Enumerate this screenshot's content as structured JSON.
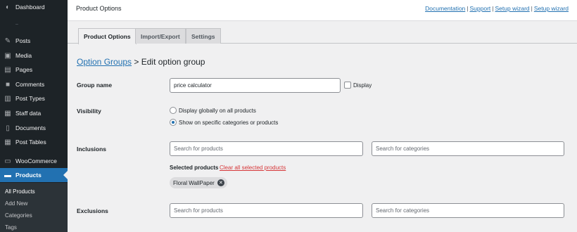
{
  "sidebar": {
    "items": [
      {
        "label": "Dashboard",
        "icon": "dashboard-icon"
      },
      {
        "label": "Posts",
        "icon": "pin-icon"
      },
      {
        "label": "Media",
        "icon": "media-icon"
      },
      {
        "label": "Pages",
        "icon": "pages-icon"
      },
      {
        "label": "Comments",
        "icon": "comments-icon"
      },
      {
        "label": "Post Types",
        "icon": "post-types-icon"
      },
      {
        "label": "Staff data",
        "icon": "table-icon"
      },
      {
        "label": "Documents",
        "icon": "document-icon"
      },
      {
        "label": "Post Tables",
        "icon": "table-icon"
      },
      {
        "label": "WooCommerce",
        "icon": "woocommerce-icon"
      },
      {
        "label": "Products",
        "icon": "products-icon"
      }
    ],
    "submenu": [
      "All Products",
      "Add New",
      "Categories",
      "Tags"
    ]
  },
  "header": {
    "title": "Product Options",
    "links": [
      "Documentation",
      "Support",
      "Setup wizard",
      "Setup wizard"
    ],
    "separator": "|"
  },
  "tabs": [
    "Product Options",
    "Import/Export",
    "Settings"
  ],
  "heading": {
    "crumb": "Option Groups",
    "arrow": ">",
    "title": "Edit option group"
  },
  "form": {
    "group_name": {
      "label": "Group name",
      "value": "price calculator",
      "display_label": "Display"
    },
    "visibility": {
      "label": "Visibility",
      "options": [
        "Display globally on all products",
        "Show on specific categories or products"
      ],
      "selected_index": 1
    },
    "inclusions": {
      "label": "Inclusions",
      "products_placeholder": "Search for products",
      "categories_placeholder": "Search for categories",
      "selected_label": "Selected products",
      "clear_label": "Clear all selected products",
      "chips": [
        "Floral WallPaper"
      ]
    },
    "exclusions": {
      "label": "Exclusions",
      "products_placeholder": "Search for products",
      "categories_placeholder": "Search for categories"
    }
  },
  "colors": {
    "sidebar_bg": "#1d2327",
    "accent": "#2271b1",
    "danger": "#d63638",
    "page_bg": "#f0f0f1"
  }
}
